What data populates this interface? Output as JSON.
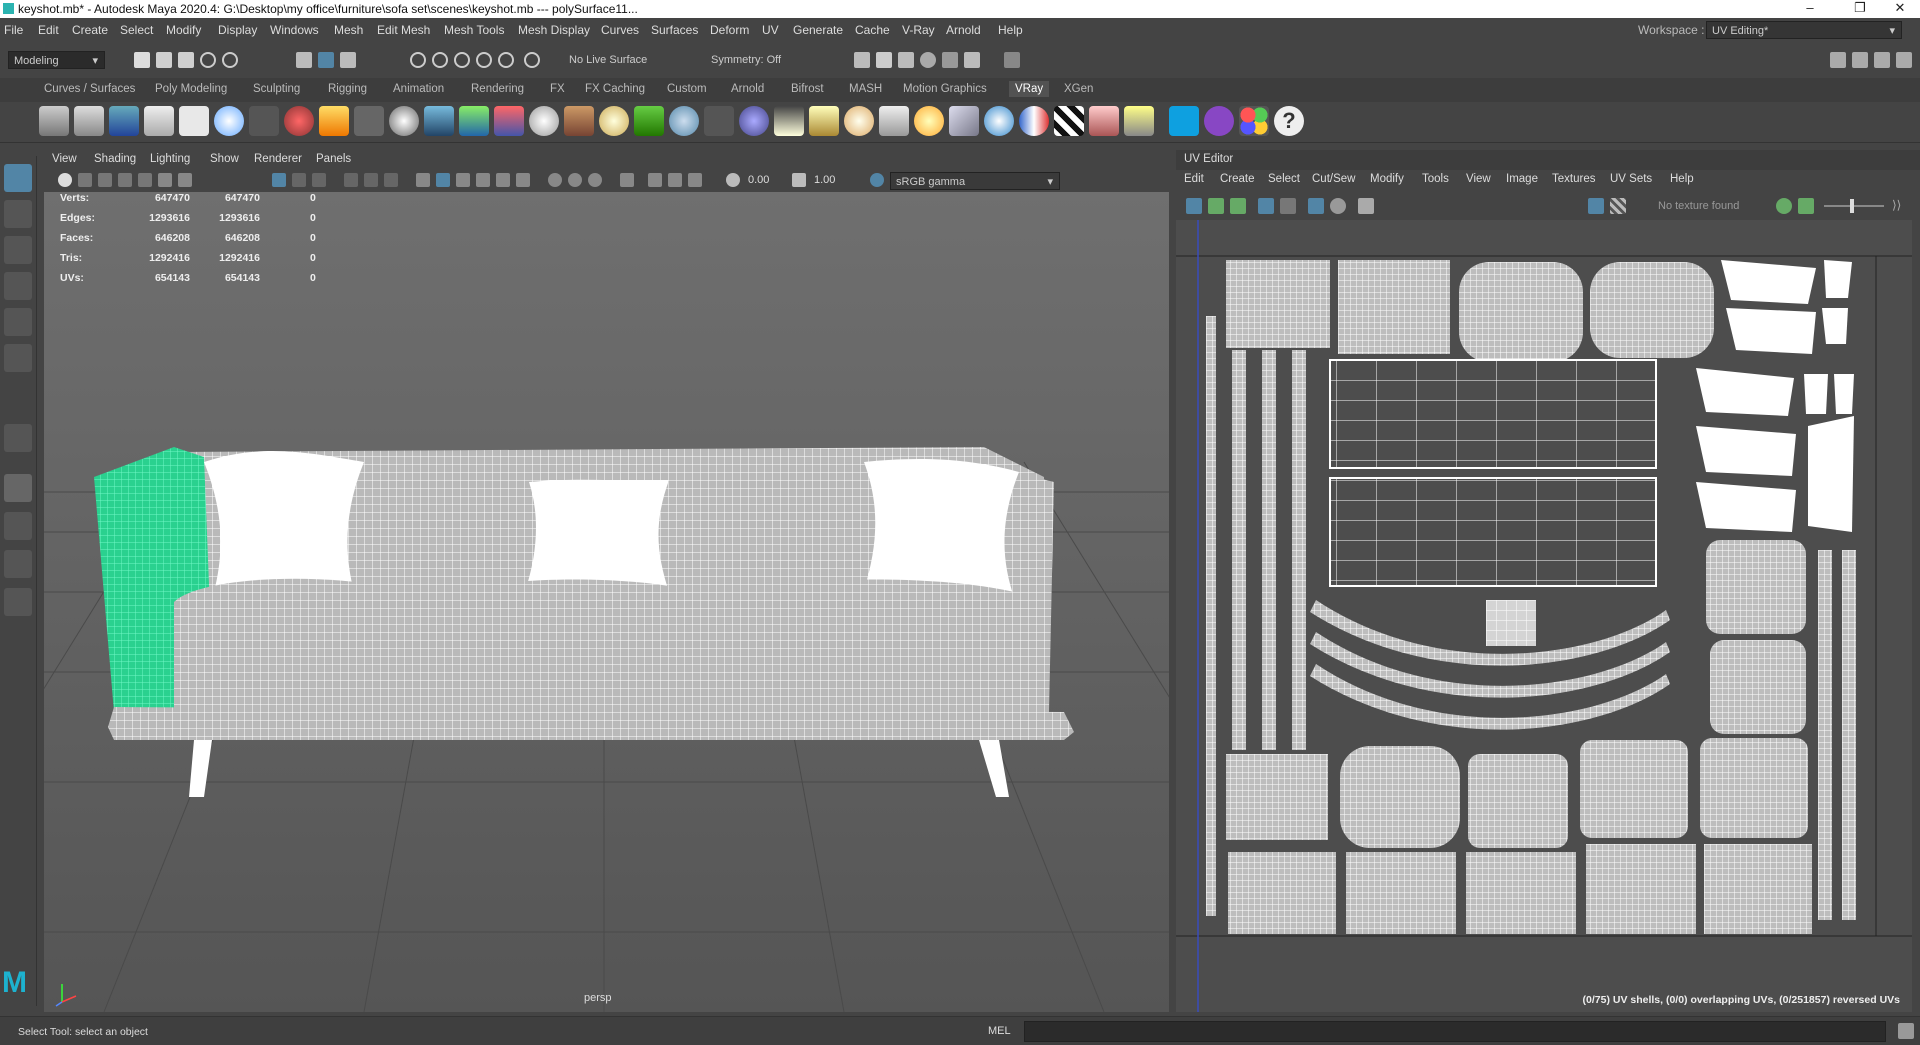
{
  "window": {
    "title": "keyshot.mb* - Autodesk Maya 2020.4: G:\\Desktop\\my office\\furniture\\sofa set\\scenes\\keyshot.mb   ---   polySurface11...",
    "controls": [
      "–",
      "❐",
      "✕"
    ]
  },
  "menubar": {
    "items": [
      "File",
      "Edit",
      "Create",
      "Select",
      "Modify",
      "Display",
      "Windows",
      "Mesh",
      "Edit Mesh",
      "Mesh Tools",
      "Mesh Display",
      "Curves",
      "Surfaces",
      "Deform",
      "UV",
      "Generate",
      "Cache",
      "V-Ray",
      "Arnold",
      "Help"
    ],
    "workspace_label": "Workspace :",
    "workspace_value": "UV Editing*"
  },
  "statusline": {
    "mode": "Modeling",
    "live_surface": "No Live Surface",
    "symmetry": "Symmetry: Off"
  },
  "shelf": {
    "tabs": [
      "Curves / Surfaces",
      "Poly Modeling",
      "Sculpting",
      "Rigging",
      "Animation",
      "Rendering",
      "FX",
      "FX Caching",
      "Custom",
      "Arnold",
      "Bifrost",
      "MASH",
      "Motion Graphics",
      "VRay",
      "XGen"
    ],
    "active_tab": "VRay"
  },
  "viewport": {
    "menu": [
      "View",
      "Shading",
      "Lighting",
      "Show",
      "Renderer",
      "Panels"
    ],
    "exposure": "0.00",
    "gamma": "1.00",
    "color_space": "sRGB gamma",
    "camera": "persp",
    "hud": [
      {
        "label": "Verts:",
        "a": "647470",
        "b": "647470",
        "c": "0"
      },
      {
        "label": "Edges:",
        "a": "1293616",
        "b": "1293616",
        "c": "0"
      },
      {
        "label": "Faces:",
        "a": "646208",
        "b": "646208",
        "c": "0"
      },
      {
        "label": "Tris:",
        "a": "1292416",
        "b": "1292416",
        "c": "0"
      },
      {
        "label": "UVs:",
        "a": "654143",
        "b": "654143",
        "c": "0"
      }
    ]
  },
  "uv_editor": {
    "title": "UV Editor",
    "menu": [
      "Edit",
      "Create",
      "Select",
      "Cut/Sew",
      "Modify",
      "Tools",
      "View",
      "Image",
      "Textures",
      "UV Sets",
      "Help"
    ],
    "texture_status": "No texture found",
    "status": "(0/75) UV shells, (0/0) overlapping UVs, (0/251857) reversed UVs"
  },
  "helpline": {
    "text": "Select Tool: select an object",
    "mel": "MEL"
  },
  "colors": {
    "accent": "#5285a6",
    "selection": "#3fe6a7"
  }
}
